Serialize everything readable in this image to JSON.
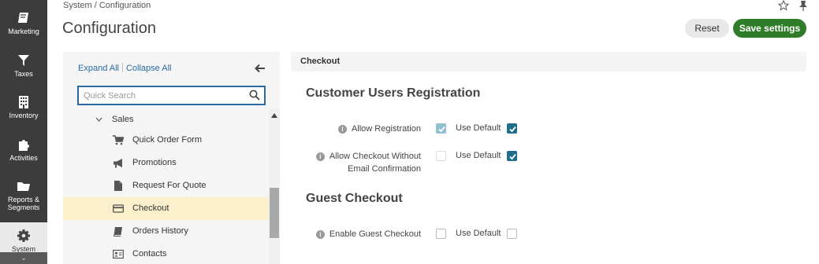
{
  "nav": {
    "items": [
      {
        "label": "Marketing",
        "icon": "book-icon"
      },
      {
        "label": "Taxes",
        "icon": "funnel-icon"
      },
      {
        "label": "Inventory",
        "icon": "building-icon"
      },
      {
        "label": "Activities",
        "icon": "puzzle-icon"
      },
      {
        "label": "Reports & Segments",
        "icon": "folder-icon"
      },
      {
        "label": "System",
        "icon": "gear-icon"
      }
    ]
  },
  "header": {
    "breadcrumb": "System / Configuration",
    "title": "Configuration",
    "reset_label": "Reset",
    "save_label": "Save settings"
  },
  "tree": {
    "expand_all": "Expand All",
    "collapse_all": "Collapse All",
    "search_placeholder": "Quick Search",
    "parent": "Sales",
    "items": [
      {
        "label": "Quick Order Form",
        "icon": "cart-icon"
      },
      {
        "label": "Promotions",
        "icon": "megaphone-icon"
      },
      {
        "label": "Request For Quote",
        "icon": "document-icon"
      },
      {
        "label": "Checkout",
        "icon": "credit-card-icon",
        "selected": true
      },
      {
        "label": "Orders History",
        "icon": "book-icon"
      },
      {
        "label": "Contacts",
        "icon": "contact-card-icon"
      }
    ]
  },
  "content": {
    "section": "Checkout",
    "groups": [
      {
        "title": "Customer Users Registration",
        "fields": [
          {
            "label": "Allow Registration",
            "value_checked": true,
            "use_default_label": "Use Default",
            "use_default": true
          },
          {
            "label_line1": "Allow Checkout Without",
            "label_line2": "Email Confirmation",
            "value_checked": false,
            "use_default_label": "Use Default",
            "use_default": true
          }
        ]
      },
      {
        "title": "Guest Checkout",
        "fields": [
          {
            "label": "Enable Guest Checkout",
            "value_checked": false,
            "use_default_label": "Use Default",
            "use_default": false
          }
        ]
      }
    ]
  },
  "colors": {
    "nav_bg": "#3c3c3c",
    "accent": "#2a6aa0",
    "save": "#2f7d28",
    "selected_row": "#fcefcc",
    "checkbox": "#1f6f8b"
  }
}
